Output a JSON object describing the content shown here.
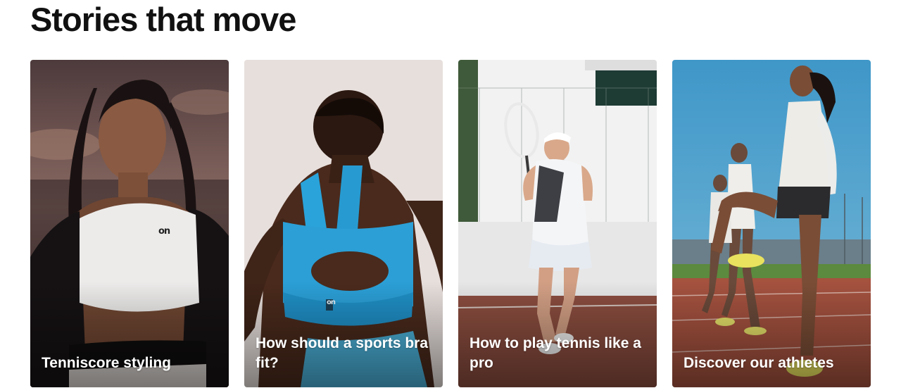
{
  "section": {
    "title": "Stories that move"
  },
  "cards": [
    {
      "caption": "Tenniscore styling",
      "image": "woman-in-white-crop-top-photo",
      "brand_mark": "on"
    },
    {
      "caption": "How should a sports bra fit?",
      "image": "woman-in-blue-sports-bra-photo",
      "brand_mark": "on"
    },
    {
      "caption": "How to play tennis like a pro",
      "image": "tennis-player-swinging-racket-photo"
    },
    {
      "caption": "Discover our athletes",
      "image": "athletes-training-on-track-photo"
    }
  ],
  "colors": {
    "card1_sky": "#6b5553",
    "card2_bg": "#e6dedb",
    "sports_bra_blue": "#2a9fd6",
    "card3_court": "#8a4a3c",
    "card4_sky": "#4fa3d1",
    "track_red": "#a5523f"
  }
}
